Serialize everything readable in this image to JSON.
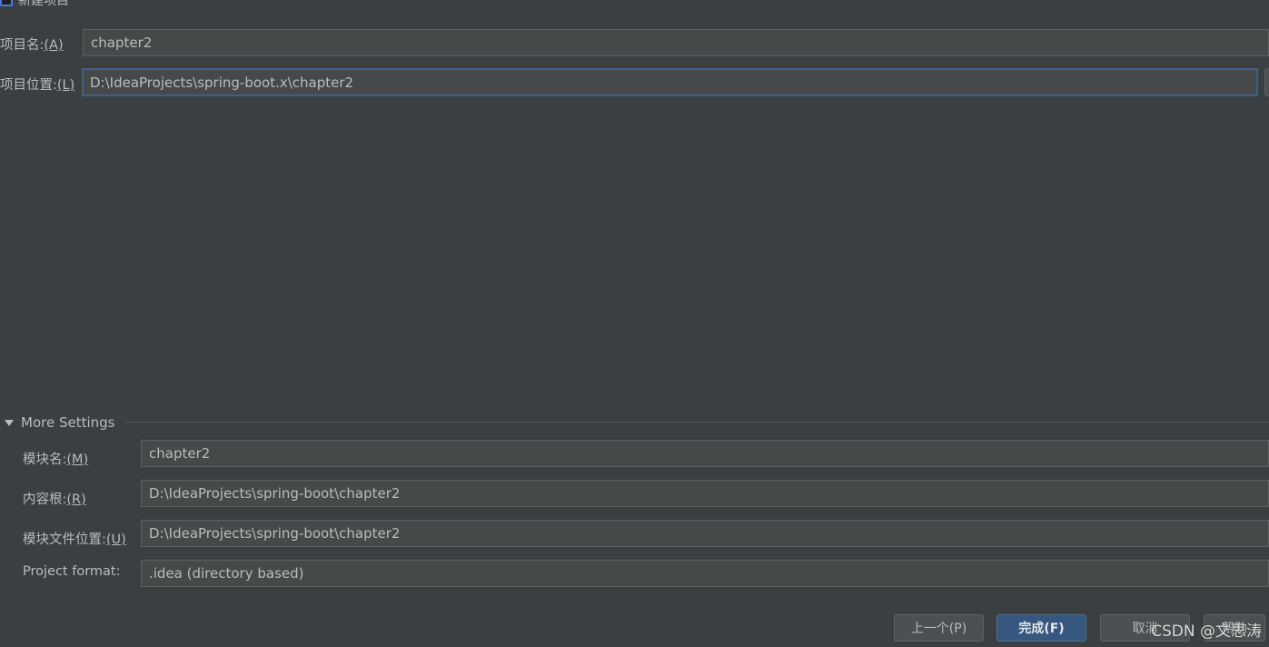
{
  "window": {
    "title": "新建项目"
  },
  "form": {
    "name_label": "项目名:",
    "name_mnemonic": "(A)",
    "name_value": "chapter2",
    "location_label": "项目位置:",
    "location_mnemonic": "(L)",
    "location_value": "D:\\IdeaProjects\\spring-boot.x\\chapter2"
  },
  "more_settings": {
    "header": "More Settings",
    "module_name_label": "模块名:",
    "module_name_mnemonic": "(M)",
    "module_name_value": "chapter2",
    "content_root_label": "内容根:",
    "content_root_mnemonic": "(R)",
    "content_root_value": "D:\\IdeaProjects\\spring-boot\\chapter2",
    "module_file_label": "模块文件位置:",
    "module_file_mnemonic": "(U)",
    "module_file_value": "D:\\IdeaProjects\\spring-boot\\chapter2",
    "project_format_label": "Project format:",
    "project_format_value": ".idea (directory based)"
  },
  "buttons": {
    "previous": "上一个(P)",
    "finish": "完成(F)",
    "cancel": "取消",
    "help": "帮助"
  },
  "watermark": "CSDN @文思涛"
}
